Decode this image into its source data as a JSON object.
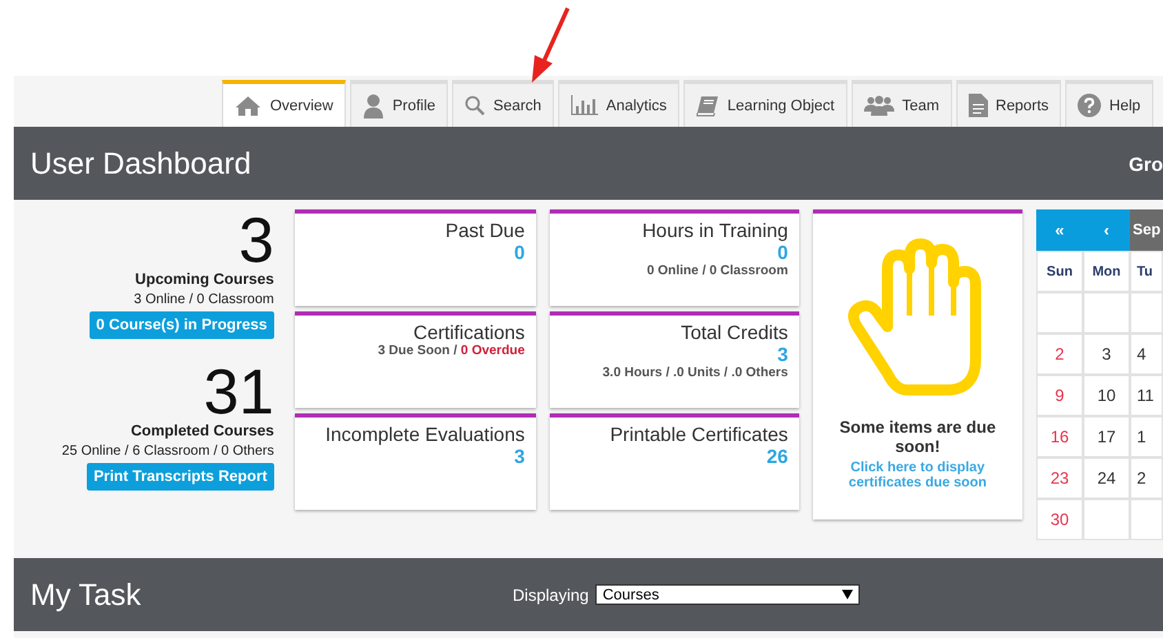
{
  "tabs": [
    {
      "label": "Overview",
      "selected": true
    },
    {
      "label": "Profile",
      "selected": false
    },
    {
      "label": "Search",
      "selected": false
    },
    {
      "label": "Analytics",
      "selected": false
    },
    {
      "label": "Learning Object",
      "selected": false
    },
    {
      "label": "Team",
      "selected": false
    },
    {
      "label": "Reports",
      "selected": false
    },
    {
      "label": "Help",
      "selected": false
    }
  ],
  "dashboard": {
    "title": "User Dashboard",
    "right_label": "Gro"
  },
  "summary": [
    {
      "count": "3",
      "label": "Upcoming Courses",
      "detail": "3 Online / 0 Classroom",
      "button": "0 Course(s) in Progress"
    },
    {
      "count": "31",
      "label": "Completed Courses",
      "detail": "25 Online / 6 Classroom / 0 Others",
      "button": "Print Transcripts Report"
    }
  ],
  "cards": [
    {
      "title": "Past Due",
      "value": "0"
    },
    {
      "title": "Hours in Training",
      "value": "0",
      "detail": "0 Online / 0 Classroom"
    },
    {
      "title": "Certifications",
      "detail": "3 Due Soon / ",
      "alert": "0 Overdue"
    },
    {
      "title": "Total Credits",
      "value": "3",
      "detail": "3.0 Hours / .0 Units / .0 Others"
    },
    {
      "title": "Incomplete Evaluations",
      "value": "3"
    },
    {
      "title": "Printable Certificates",
      "value": "26"
    }
  ],
  "notice": {
    "message": "Some items are due soon!",
    "link": "Click here to display certificates due soon"
  },
  "calendar": {
    "nav": [
      "«",
      "‹"
    ],
    "month": "Sep",
    "weekdays": [
      "Sun",
      "Mon",
      "Tu"
    ],
    "weeks": [
      [
        "2",
        "3",
        "4"
      ],
      [
        "9",
        "10",
        "11"
      ],
      [
        "16",
        "17",
        "1"
      ],
      [
        "23",
        "24",
        "2"
      ],
      [
        "30"
      ]
    ]
  },
  "my_task": {
    "title": "My Task",
    "filter_label": "Displaying",
    "filter_value": "Courses"
  }
}
